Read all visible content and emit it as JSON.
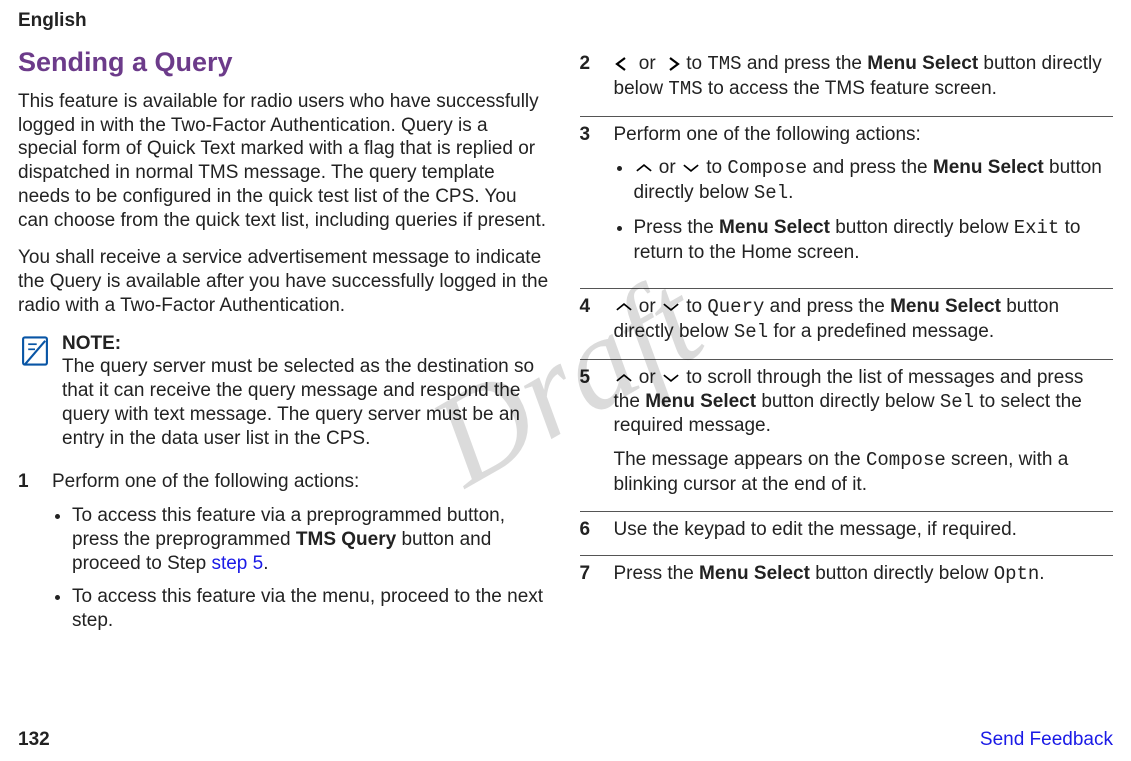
{
  "header": {
    "language": "English"
  },
  "title": "Sending a Query",
  "intro1": "This feature is available for radio users who have successfully logged in with the Two-Factor Authentication. Query is a special form of Quick Text marked with a flag that is replied or dispatched in normal TMS message. The query template needs to be configured in the quick test list of the CPS. You can choose from the quick text list, including queries if present.",
  "intro2": "You shall receive a service advertisement message to indicate the Query is available after you have successfully logged in the radio with a Two-Factor Authentication.",
  "note": {
    "label": "NOTE:",
    "text": "The query server must be selected as the destination so that it can receive the query message and respond the query with text message. The query server must be an entry in the data user list in the CPS."
  },
  "left_steps": {
    "s1_intro": "Perform one of the following actions:",
    "s1_b1_a": "To access this feature via a preprogrammed button, press the preprogrammed ",
    "s1_b1_bold": "TMS Query",
    "s1_b1_b": " button and proceed to Step ",
    "s1_b1_link": "step 5",
    "s1_b1_c": ".",
    "s1_b2": "To access this feature via the menu, proceed to the next step."
  },
  "right_steps": {
    "s2_a": " or ",
    "s2_b": " to ",
    "s2_tms": "TMS",
    "s2_c": " and press the ",
    "s2_menu": "Menu Select",
    "s2_d": " button directly below ",
    "s2_e": " to access the TMS feature screen.",
    "s3_intro": "Perform one of the following actions:",
    "s3_b1_a": " or ",
    "s3_b1_b": " to ",
    "s3_b1_compose": "Compose",
    "s3_b1_c": " and press the ",
    "s3_b1_menu": "Menu Select",
    "s3_b1_d": " button directly below ",
    "s3_b1_sel": "Sel",
    "s3_b1_e": ".",
    "s3_b2_a": "Press the ",
    "s3_b2_menu": "Menu Select",
    "s3_b2_b": " button directly below ",
    "s3_b2_exit": "Exit",
    "s3_b2_c": " to return to the Home screen.",
    "s4_a": " or ",
    "s4_b": " to ",
    "s4_query": "Query",
    "s4_c": " and press the ",
    "s4_menu": "Menu Select",
    "s4_d": " button directly below ",
    "s4_sel": "Sel",
    "s4_e": " for a predefined message.",
    "s5_a": " or ",
    "s5_b": " to scroll through the list of messages and press the ",
    "s5_menu": "Menu Select",
    "s5_c": " button directly below ",
    "s5_sel": "Sel",
    "s5_d": " to select the required message.",
    "s5_p2a": "The message appears on the ",
    "s5_compose": "Compose",
    "s5_p2b": " screen, with a blinking cursor at the end of it.",
    "s6": "Use the keypad to edit the message, if required.",
    "s7_a": "Press the ",
    "s7_menu": "Menu Select",
    "s7_b": " button directly below ",
    "s7_optn": "Optn",
    "s7_c": "."
  },
  "step_nums": {
    "n1": "1",
    "n2": "2",
    "n3": "3",
    "n4": "4",
    "n5": "5",
    "n6": "6",
    "n7": "7"
  },
  "footer": {
    "page": "132",
    "feedback": "Send Feedback"
  },
  "watermark": "Draft"
}
